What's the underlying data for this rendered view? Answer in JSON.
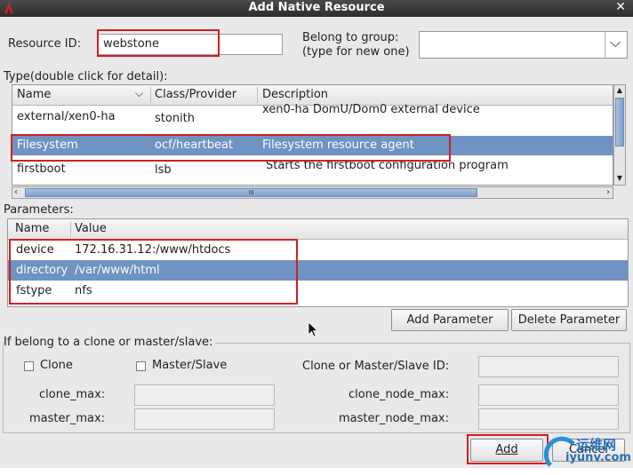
{
  "window": {
    "title": "Add Native Resource",
    "close_glyph": "✕"
  },
  "resource_id": {
    "label": "Resource ID:",
    "value": "webstone"
  },
  "group": {
    "label_line1": "Belong to group:",
    "label_line2": "(type for new one)",
    "value": "",
    "dropdown_glyph": "⌵"
  },
  "type_section": {
    "label": "Type(double click for detail):",
    "columns": {
      "name": "Name",
      "class": "Class/Provider",
      "description": "Description"
    },
    "rows": [
      {
        "name": "external/xen0-ha",
        "class": "stonith",
        "description": "xen0-ha DomU/Dom0 external device"
      },
      {
        "name": "Filesystem",
        "class": "ocf/heartbeat",
        "description": "Filesystem resource agent"
      },
      {
        "name": "firstboot",
        "class": "lsb",
        "description": "Starts the firstboot configuration program"
      }
    ],
    "hscroll_grip": "III"
  },
  "parameters": {
    "label": "Parameters:",
    "columns": {
      "name": "Name",
      "value": "Value"
    },
    "rows": [
      {
        "name": "device",
        "value": "172.16.31.12:/www/htdocs"
      },
      {
        "name": "directory",
        "value": "/var/www/html"
      },
      {
        "name": "fstype",
        "value": "nfs"
      }
    ],
    "add_label": "Add Parameter",
    "delete_label": "Delete Parameter"
  },
  "clone": {
    "label": "If belong to a clone or master/slave:",
    "clone_checkbox": "Clone",
    "master_slave_checkbox": "Master/Slave",
    "id_label": "Clone or Master/Slave ID:",
    "clone_max": "clone_max:",
    "clone_node_max": "clone_node_max:",
    "master_max": "master_max:",
    "master_node_max": "master_node_max:"
  },
  "buttons": {
    "add": "Add",
    "cancel": "Cancel"
  },
  "watermark": {
    "text_cn": "运维网",
    "text_en": "iyunv.com"
  },
  "colors": {
    "selection": "#6f93c2",
    "highlight": "#d02020",
    "titlebar": "#333333"
  }
}
